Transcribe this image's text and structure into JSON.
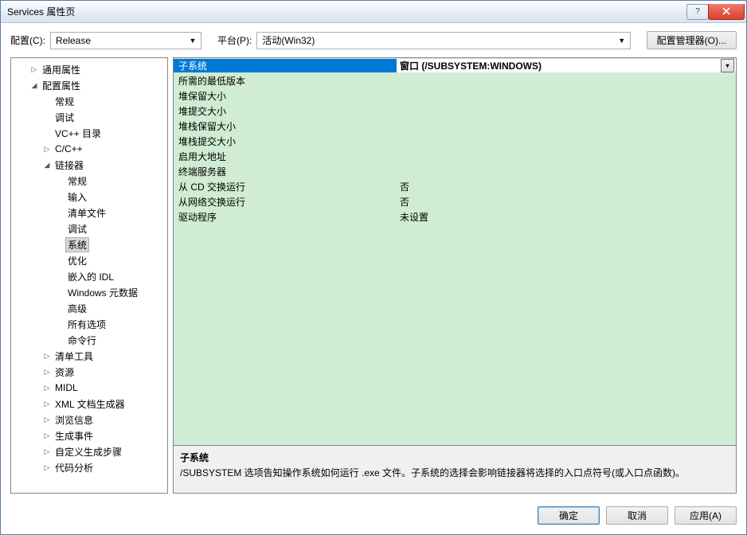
{
  "window": {
    "title": "Services 属性页"
  },
  "toolbar": {
    "config_label": "配置(C):",
    "config_value": "Release",
    "platform_label": "平台(P):",
    "platform_value": "活动(Win32)",
    "config_manager": "配置管理器(O)..."
  },
  "tree": {
    "items": [
      {
        "label": "通用属性",
        "indent": 1,
        "exp": "▷"
      },
      {
        "label": "配置属性",
        "indent": 1,
        "exp": "◢"
      },
      {
        "label": "常规",
        "indent": 2,
        "exp": ""
      },
      {
        "label": "调试",
        "indent": 2,
        "exp": ""
      },
      {
        "label": "VC++ 目录",
        "indent": 2,
        "exp": ""
      },
      {
        "label": "C/C++",
        "indent": 2,
        "exp": "▷"
      },
      {
        "label": "链接器",
        "indent": 2,
        "exp": "◢"
      },
      {
        "label": "常规",
        "indent": 3,
        "exp": ""
      },
      {
        "label": "输入",
        "indent": 3,
        "exp": ""
      },
      {
        "label": "清单文件",
        "indent": 3,
        "exp": ""
      },
      {
        "label": "调试",
        "indent": 3,
        "exp": ""
      },
      {
        "label": "系统",
        "indent": 3,
        "exp": "",
        "selected": true
      },
      {
        "label": "优化",
        "indent": 3,
        "exp": ""
      },
      {
        "label": "嵌入的 IDL",
        "indent": 3,
        "exp": ""
      },
      {
        "label": "Windows 元数据",
        "indent": 3,
        "exp": ""
      },
      {
        "label": "高级",
        "indent": 3,
        "exp": ""
      },
      {
        "label": "所有选项",
        "indent": 3,
        "exp": ""
      },
      {
        "label": "命令行",
        "indent": 3,
        "exp": ""
      },
      {
        "label": "清单工具",
        "indent": 2,
        "exp": "▷"
      },
      {
        "label": "资源",
        "indent": 2,
        "exp": "▷"
      },
      {
        "label": "MIDL",
        "indent": 2,
        "exp": "▷"
      },
      {
        "label": "XML 文档生成器",
        "indent": 2,
        "exp": "▷"
      },
      {
        "label": "浏览信息",
        "indent": 2,
        "exp": "▷"
      },
      {
        "label": "生成事件",
        "indent": 2,
        "exp": "▷"
      },
      {
        "label": "自定义生成步骤",
        "indent": 2,
        "exp": "▷"
      },
      {
        "label": "代码分析",
        "indent": 2,
        "exp": "▷"
      }
    ]
  },
  "props": {
    "rows": [
      {
        "label": "子系统",
        "value": "窗口 (/SUBSYSTEM:WINDOWS)",
        "selected": true
      },
      {
        "label": "所需的最低版本",
        "value": ""
      },
      {
        "label": "堆保留大小",
        "value": ""
      },
      {
        "label": "堆提交大小",
        "value": ""
      },
      {
        "label": "堆栈保留大小",
        "value": ""
      },
      {
        "label": "堆栈提交大小",
        "value": ""
      },
      {
        "label": "启用大地址",
        "value": ""
      },
      {
        "label": "终端服务器",
        "value": ""
      },
      {
        "label": "从 CD 交换运行",
        "value": "否"
      },
      {
        "label": "从网络交换运行",
        "value": "否"
      },
      {
        "label": "驱动程序",
        "value": "未设置"
      }
    ]
  },
  "desc": {
    "title": "子系统",
    "text": "/SUBSYSTEM 选项告知操作系统如何运行 .exe 文件。子系统的选择会影响链接器将选择的入口点符号(或入口点函数)。"
  },
  "footer": {
    "ok": "确定",
    "cancel": "取消",
    "apply": "应用(A)"
  }
}
